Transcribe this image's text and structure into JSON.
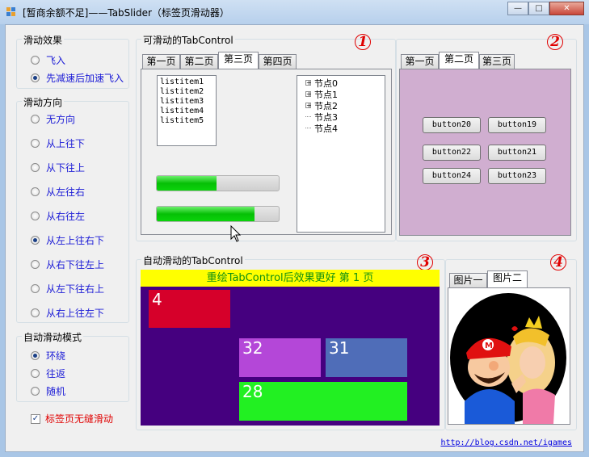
{
  "window": {
    "title": "[暂商余额不足]——TabSlider（标签页滑动器）",
    "controls": [
      "minimize-icon",
      "maximize-icon",
      "close-icon"
    ]
  },
  "slide_effect": {
    "title": "滑动效果",
    "options": [
      {
        "label": "飞入",
        "selected": false
      },
      {
        "label": "先减速后加速飞入",
        "selected": true
      }
    ]
  },
  "slide_direction": {
    "title": "滑动方向",
    "options": [
      {
        "label": "无方向",
        "selected": false
      },
      {
        "label": "从上往下",
        "selected": false
      },
      {
        "label": "从下往上",
        "selected": false
      },
      {
        "label": "从左往右",
        "selected": false
      },
      {
        "label": "从右往左",
        "selected": false
      },
      {
        "label": "从左上往右下",
        "selected": true
      },
      {
        "label": "从右下往左上",
        "selected": false
      },
      {
        "label": "从左下往右上",
        "selected": false
      },
      {
        "label": "从右上往左下",
        "selected": false
      }
    ]
  },
  "auto_mode": {
    "title": "自动滑动模式",
    "options": [
      {
        "label": "环绕",
        "selected": true
      },
      {
        "label": "往返",
        "selected": false
      },
      {
        "label": "随机",
        "selected": false
      }
    ]
  },
  "seamless": {
    "label": "标签页无缝滑动",
    "checked": true,
    "color": "#e00000"
  },
  "group1": {
    "title": "可滑动的TabControl",
    "badge": "1",
    "tabs": [
      "第一页",
      "第二页",
      "第三页",
      "第四页"
    ],
    "active_tab": 2,
    "list_items": [
      "listitem1",
      "listitem2",
      "listitem3",
      "listitem4",
      "listitem5"
    ],
    "tree_nodes": [
      {
        "label": "节点0",
        "expandable": true
      },
      {
        "label": "节点1",
        "expandable": true
      },
      {
        "label": "节点2",
        "expandable": true
      },
      {
        "label": "节点3",
        "expandable": false
      },
      {
        "label": "节点4",
        "expandable": false
      }
    ],
    "progress": [
      0.49,
      0.8
    ]
  },
  "group2": {
    "badge": "2",
    "tabs": [
      "第一页",
      "第二页",
      "第三页"
    ],
    "active_tab": 1,
    "page_color": "#d0aed0",
    "buttons": [
      "button20",
      "button19",
      "button22",
      "button21",
      "button24",
      "button23"
    ]
  },
  "group3": {
    "title": "自动滑动的TabControl",
    "badge": "3",
    "banner": "重绘TabControl后效果更好 第 1 页",
    "banner_bg": "#ffff00",
    "banner_fg": "#109010",
    "panel_bg": "#45007f",
    "blocks": [
      {
        "label": "4",
        "color": "#d6002a"
      },
      {
        "label": "32",
        "color": "#b447d8"
      },
      {
        "label": "31",
        "color": "#4f6db8"
      },
      {
        "label": "28",
        "color": "#22f022"
      }
    ]
  },
  "group4": {
    "badge": "4",
    "tabs": [
      "图片一",
      "图片二"
    ],
    "active_tab": 1,
    "image": "mario-peach-kiss-image"
  },
  "footer_link": "http://blog.csdn.net/igames"
}
